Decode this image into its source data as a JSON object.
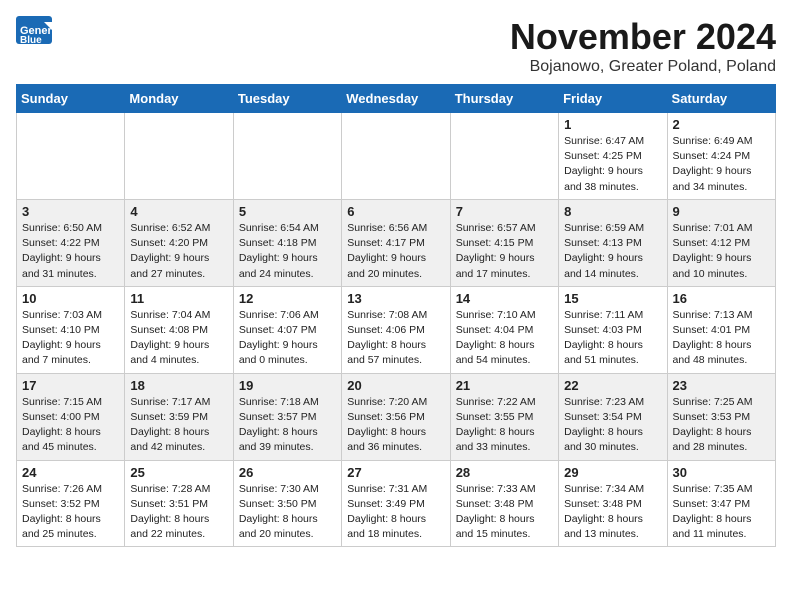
{
  "header": {
    "logo_general": "General",
    "logo_blue": "Blue",
    "month_title": "November 2024",
    "location": "Bojanowo, Greater Poland, Poland"
  },
  "days_of_week": [
    "Sunday",
    "Monday",
    "Tuesday",
    "Wednesday",
    "Thursday",
    "Friday",
    "Saturday"
  ],
  "weeks": [
    [
      {
        "day": "",
        "info": ""
      },
      {
        "day": "",
        "info": ""
      },
      {
        "day": "",
        "info": ""
      },
      {
        "day": "",
        "info": ""
      },
      {
        "day": "",
        "info": ""
      },
      {
        "day": "1",
        "info": "Sunrise: 6:47 AM\nSunset: 4:25 PM\nDaylight: 9 hours\nand 38 minutes."
      },
      {
        "day": "2",
        "info": "Sunrise: 6:49 AM\nSunset: 4:24 PM\nDaylight: 9 hours\nand 34 minutes."
      }
    ],
    [
      {
        "day": "3",
        "info": "Sunrise: 6:50 AM\nSunset: 4:22 PM\nDaylight: 9 hours\nand 31 minutes."
      },
      {
        "day": "4",
        "info": "Sunrise: 6:52 AM\nSunset: 4:20 PM\nDaylight: 9 hours\nand 27 minutes."
      },
      {
        "day": "5",
        "info": "Sunrise: 6:54 AM\nSunset: 4:18 PM\nDaylight: 9 hours\nand 24 minutes."
      },
      {
        "day": "6",
        "info": "Sunrise: 6:56 AM\nSunset: 4:17 PM\nDaylight: 9 hours\nand 20 minutes."
      },
      {
        "day": "7",
        "info": "Sunrise: 6:57 AM\nSunset: 4:15 PM\nDaylight: 9 hours\nand 17 minutes."
      },
      {
        "day": "8",
        "info": "Sunrise: 6:59 AM\nSunset: 4:13 PM\nDaylight: 9 hours\nand 14 minutes."
      },
      {
        "day": "9",
        "info": "Sunrise: 7:01 AM\nSunset: 4:12 PM\nDaylight: 9 hours\nand 10 minutes."
      }
    ],
    [
      {
        "day": "10",
        "info": "Sunrise: 7:03 AM\nSunset: 4:10 PM\nDaylight: 9 hours\nand 7 minutes."
      },
      {
        "day": "11",
        "info": "Sunrise: 7:04 AM\nSunset: 4:08 PM\nDaylight: 9 hours\nand 4 minutes."
      },
      {
        "day": "12",
        "info": "Sunrise: 7:06 AM\nSunset: 4:07 PM\nDaylight: 9 hours\nand 0 minutes."
      },
      {
        "day": "13",
        "info": "Sunrise: 7:08 AM\nSunset: 4:06 PM\nDaylight: 8 hours\nand 57 minutes."
      },
      {
        "day": "14",
        "info": "Sunrise: 7:10 AM\nSunset: 4:04 PM\nDaylight: 8 hours\nand 54 minutes."
      },
      {
        "day": "15",
        "info": "Sunrise: 7:11 AM\nSunset: 4:03 PM\nDaylight: 8 hours\nand 51 minutes."
      },
      {
        "day": "16",
        "info": "Sunrise: 7:13 AM\nSunset: 4:01 PM\nDaylight: 8 hours\nand 48 minutes."
      }
    ],
    [
      {
        "day": "17",
        "info": "Sunrise: 7:15 AM\nSunset: 4:00 PM\nDaylight: 8 hours\nand 45 minutes."
      },
      {
        "day": "18",
        "info": "Sunrise: 7:17 AM\nSunset: 3:59 PM\nDaylight: 8 hours\nand 42 minutes."
      },
      {
        "day": "19",
        "info": "Sunrise: 7:18 AM\nSunset: 3:57 PM\nDaylight: 8 hours\nand 39 minutes."
      },
      {
        "day": "20",
        "info": "Sunrise: 7:20 AM\nSunset: 3:56 PM\nDaylight: 8 hours\nand 36 minutes."
      },
      {
        "day": "21",
        "info": "Sunrise: 7:22 AM\nSunset: 3:55 PM\nDaylight: 8 hours\nand 33 minutes."
      },
      {
        "day": "22",
        "info": "Sunrise: 7:23 AM\nSunset: 3:54 PM\nDaylight: 8 hours\nand 30 minutes."
      },
      {
        "day": "23",
        "info": "Sunrise: 7:25 AM\nSunset: 3:53 PM\nDaylight: 8 hours\nand 28 minutes."
      }
    ],
    [
      {
        "day": "24",
        "info": "Sunrise: 7:26 AM\nSunset: 3:52 PM\nDaylight: 8 hours\nand 25 minutes."
      },
      {
        "day": "25",
        "info": "Sunrise: 7:28 AM\nSunset: 3:51 PM\nDaylight: 8 hours\nand 22 minutes."
      },
      {
        "day": "26",
        "info": "Sunrise: 7:30 AM\nSunset: 3:50 PM\nDaylight: 8 hours\nand 20 minutes."
      },
      {
        "day": "27",
        "info": "Sunrise: 7:31 AM\nSunset: 3:49 PM\nDaylight: 8 hours\nand 18 minutes."
      },
      {
        "day": "28",
        "info": "Sunrise: 7:33 AM\nSunset: 3:48 PM\nDaylight: 8 hours\nand 15 minutes."
      },
      {
        "day": "29",
        "info": "Sunrise: 7:34 AM\nSunset: 3:48 PM\nDaylight: 8 hours\nand 13 minutes."
      },
      {
        "day": "30",
        "info": "Sunrise: 7:35 AM\nSunset: 3:47 PM\nDaylight: 8 hours\nand 11 minutes."
      }
    ]
  ]
}
